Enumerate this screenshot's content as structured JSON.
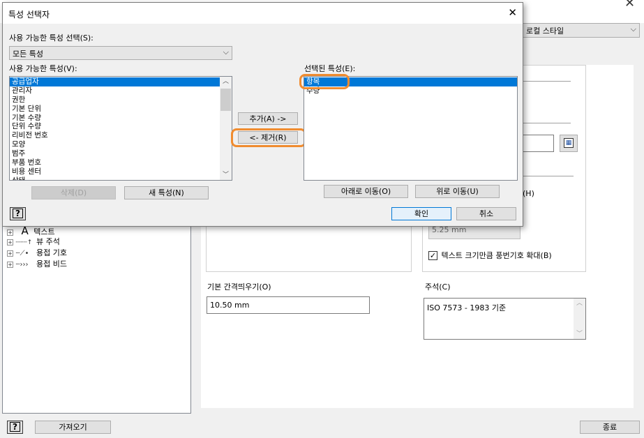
{
  "background": {
    "style_combo_value": "로컬 스타일",
    "checkbox_label": "텍스트 크기만큼 풍번기호 확대(B)",
    "checkbox_checked": true,
    "partial_label_h": "(H)",
    "disabled_value": "5.25 mm",
    "spacing_label": "기본 간격띄우기(O)",
    "spacing_value": "10.50 mm",
    "note_label": "주석(C)",
    "note_value": "ISO 7573 - 1983 기준",
    "tree_items": [
      {
        "label": "텍스트",
        "icon": "text-A-icon"
      },
      {
        "label": "뷰 주석",
        "icon": "view-annotation-icon"
      },
      {
        "label": "용접 기호",
        "icon": "weld-symbol-icon"
      },
      {
        "label": "용접 비드",
        "icon": "weld-bead-icon"
      }
    ],
    "import_button": "가져오기",
    "close_button": "종료"
  },
  "dialog": {
    "title": "특성 선택자",
    "category_label": "사용 가능한 특성 선택(S):",
    "category_value": "모든 특성",
    "available_label": "사용 가능한 특성(V):",
    "available_items": [
      "공급업자",
      "관리자",
      "권한",
      "기본 단위",
      "기본 수량",
      "단위 수량",
      "리비전 번호",
      "모양",
      "범주",
      "부품 번호",
      "비용 센터",
      "상태"
    ],
    "available_selected_index": 0,
    "add_button": "추가(A) ->",
    "remove_button": "<- 제거(R)",
    "selected_label": "선택된 특성(E):",
    "selected_items": [
      "항목",
      "수량"
    ],
    "selected_selected_index": 0,
    "delete_button": "삭제(D)",
    "new_button": "새 특성(N)",
    "move_down_button": "아래로 이동(O)",
    "move_up_button": "위로 이동(U)",
    "ok_button": "확인",
    "cancel_button": "취소",
    "help_glyph": "?"
  },
  "colors": {
    "selection": "#0078d7",
    "highlight_annotation": "#f08c30"
  }
}
